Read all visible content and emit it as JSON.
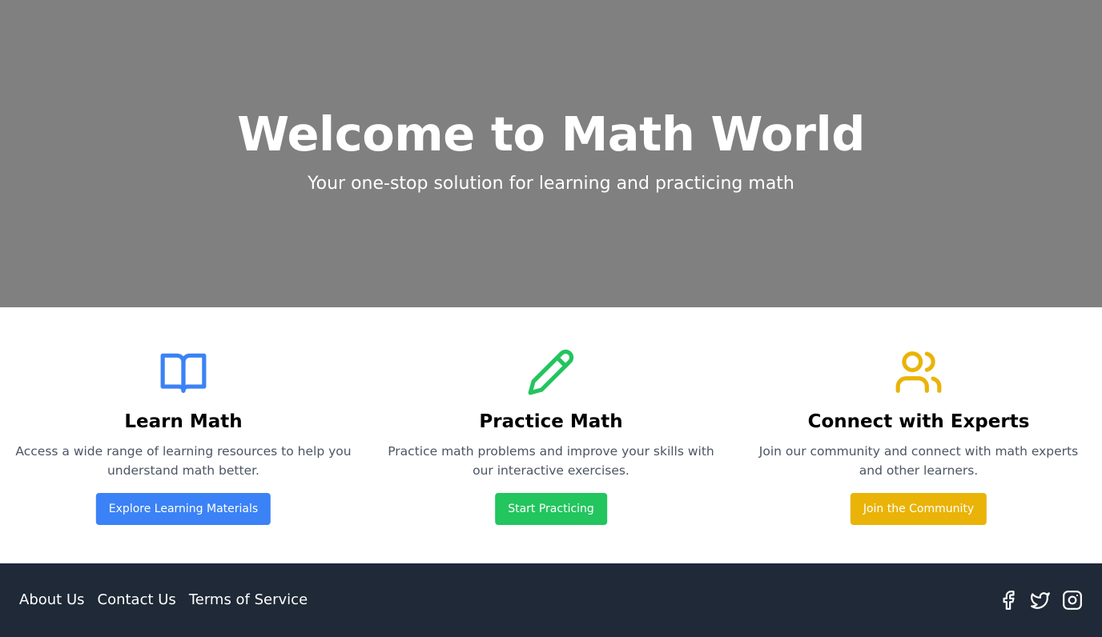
{
  "hero": {
    "title": "Welcome to Math World",
    "subtitle": "Your one-stop solution for learning and practicing math",
    "background_color": "#808080"
  },
  "features": [
    {
      "icon": "book-open-icon",
      "color": "#3b82f6",
      "title": "Learn Math",
      "description": "Access a wide range of learning resources to help you understand math better.",
      "button_label": "Explore Learning Materials"
    },
    {
      "icon": "pencil-icon",
      "color": "#22c55e",
      "title": "Practice Math",
      "description": "Practice math problems and improve your skills with our interactive exercises.",
      "button_label": "Start Practicing"
    },
    {
      "icon": "users-icon",
      "color": "#eab308",
      "title": "Connect with Experts",
      "description": "Join our community and connect with math experts and other learners.",
      "button_label": "Join the Community"
    }
  ],
  "footer": {
    "background_color": "#1f2937",
    "links": [
      "About Us",
      "Contact Us",
      "Terms of Service"
    ],
    "social_icons": [
      "facebook-icon",
      "twitter-icon",
      "instagram-icon"
    ]
  }
}
